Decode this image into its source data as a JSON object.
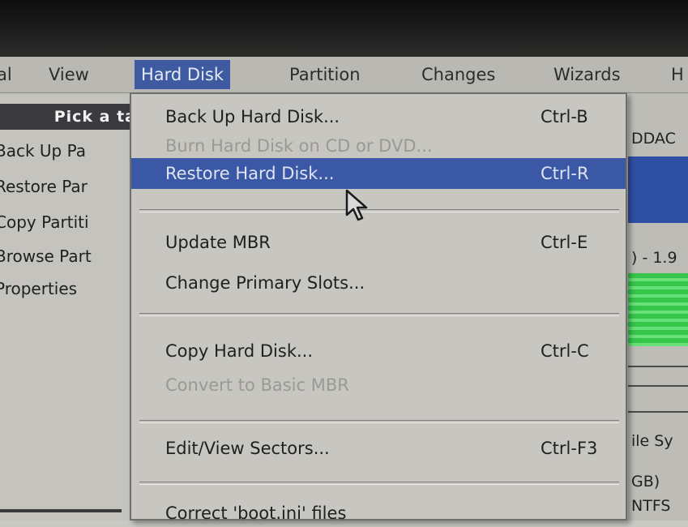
{
  "menubar": {
    "items": [
      "al",
      "View",
      "Hard Disk",
      "Partition",
      "Changes",
      "Wizards",
      "H"
    ]
  },
  "left_panel": {
    "header": "Pick a ta",
    "items": [
      "Back Up Pa",
      "Restore Par",
      "Copy Partiti",
      "Browse Part",
      "Properties"
    ]
  },
  "hard_disk_menu": {
    "items": [
      {
        "label": "Back Up Hard Disk...",
        "shortcut": "Ctrl-B"
      },
      {
        "label": "Burn Hard Disk on CD or DVD...",
        "shortcut": ""
      },
      {
        "label": "Restore Hard Disk...",
        "shortcut": "Ctrl-R"
      },
      {
        "label": "Update MBR",
        "shortcut": "Ctrl-E"
      },
      {
        "label": "Change Primary Slots...",
        "shortcut": ""
      },
      {
        "label": "Copy Hard Disk...",
        "shortcut": "Ctrl-C"
      },
      {
        "label": "Convert to Basic MBR",
        "shortcut": ""
      },
      {
        "label": "Edit/View Sectors...",
        "shortcut": "Ctrl-F3"
      },
      {
        "label": "Correct 'boot.ini' files",
        "shortcut": ""
      }
    ]
  },
  "right_panel": {
    "labels": [
      "DDAC",
      ") - 1.9",
      "ile Sy",
      "GB)",
      "NTFS"
    ]
  },
  "colors": {
    "menu_highlight": "#3a58a6",
    "usage_green": "#35c64a"
  },
  "icons": {
    "cursor": "mouse-pointer-icon"
  }
}
